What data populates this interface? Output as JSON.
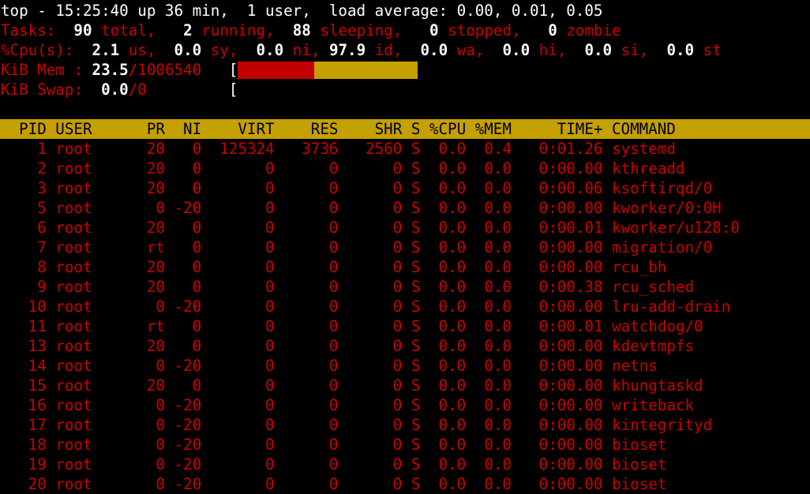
{
  "summary": {
    "line1": "top - 15:25:40 up 36 min,  1 user,  load average: 0.00, 0.01, 0.05",
    "tasks": {
      "label": "Tasks:",
      "total": "90",
      "total_label": "total,",
      "running": "2",
      "running_label": "running,",
      "sleeping": "88",
      "sleeping_label": "sleeping,",
      "stopped": "0",
      "stopped_label": "stopped,",
      "zombie": "0",
      "zombie_label": "zombie"
    },
    "cpu": {
      "label": "%Cpu(s):",
      "us": "2.1",
      "us_label": "us,",
      "sy": "0.0",
      "sy_label": "sy,",
      "ni": "0.0",
      "ni_label": "ni,",
      "id": "97.9",
      "id_label": "id,",
      "wa": "0.0",
      "wa_label": "wa,",
      "hi": "0.0",
      "hi_label": "hi,",
      "si": "0.0",
      "si_label": "si,",
      "st": "0.0",
      "st_label": "st"
    },
    "mem": {
      "label": "KiB Mem :",
      "used_pct": "23.5",
      "total": "/1006540",
      "bracket": "[",
      "bar_used_fraction": 0.425
    },
    "swap": {
      "label": "KiB Swap:",
      "used": "0.0",
      "total": "/0",
      "bracket": "["
    }
  },
  "header": "  PID USER      PR  NI    VIRT    RES    SHR S %CPU %MEM     TIME+ COMMAND",
  "columns": [
    "PID",
    "USER",
    "PR",
    "NI",
    "VIRT",
    "RES",
    "SHR",
    "S",
    "%CPU",
    "%MEM",
    "TIME+",
    "COMMAND"
  ],
  "processes": [
    {
      "pid": "1",
      "user": "root",
      "pr": "20",
      "ni": "0",
      "virt": "125324",
      "res": "3736",
      "shr": "2560",
      "s": "S",
      "cpu": "0.0",
      "mem": "0.4",
      "time": "0:01.26",
      "command": "systemd"
    },
    {
      "pid": "2",
      "user": "root",
      "pr": "20",
      "ni": "0",
      "virt": "0",
      "res": "0",
      "shr": "0",
      "s": "S",
      "cpu": "0.0",
      "mem": "0.0",
      "time": "0:00.00",
      "command": "kthreadd"
    },
    {
      "pid": "3",
      "user": "root",
      "pr": "20",
      "ni": "0",
      "virt": "0",
      "res": "0",
      "shr": "0",
      "s": "S",
      "cpu": "0.0",
      "mem": "0.0",
      "time": "0:00.06",
      "command": "ksoftirqd/0"
    },
    {
      "pid": "5",
      "user": "root",
      "pr": "0",
      "ni": "-20",
      "virt": "0",
      "res": "0",
      "shr": "0",
      "s": "S",
      "cpu": "0.0",
      "mem": "0.0",
      "time": "0:00.00",
      "command": "kworker/0:0H"
    },
    {
      "pid": "6",
      "user": "root",
      "pr": "20",
      "ni": "0",
      "virt": "0",
      "res": "0",
      "shr": "0",
      "s": "S",
      "cpu": "0.0",
      "mem": "0.0",
      "time": "0:00.01",
      "command": "kworker/u128:0"
    },
    {
      "pid": "7",
      "user": "root",
      "pr": "rt",
      "ni": "0",
      "virt": "0",
      "res": "0",
      "shr": "0",
      "s": "S",
      "cpu": "0.0",
      "mem": "0.0",
      "time": "0:00.00",
      "command": "migration/0"
    },
    {
      "pid": "8",
      "user": "root",
      "pr": "20",
      "ni": "0",
      "virt": "0",
      "res": "0",
      "shr": "0",
      "s": "S",
      "cpu": "0.0",
      "mem": "0.0",
      "time": "0:00.00",
      "command": "rcu_bh"
    },
    {
      "pid": "9",
      "user": "root",
      "pr": "20",
      "ni": "0",
      "virt": "0",
      "res": "0",
      "shr": "0",
      "s": "S",
      "cpu": "0.0",
      "mem": "0.0",
      "time": "0:00.38",
      "command": "rcu_sched"
    },
    {
      "pid": "10",
      "user": "root",
      "pr": "0",
      "ni": "-20",
      "virt": "0",
      "res": "0",
      "shr": "0",
      "s": "S",
      "cpu": "0.0",
      "mem": "0.0",
      "time": "0:00.00",
      "command": "lru-add-drain"
    },
    {
      "pid": "11",
      "user": "root",
      "pr": "rt",
      "ni": "0",
      "virt": "0",
      "res": "0",
      "shr": "0",
      "s": "S",
      "cpu": "0.0",
      "mem": "0.0",
      "time": "0:00.01",
      "command": "watchdog/0"
    },
    {
      "pid": "13",
      "user": "root",
      "pr": "20",
      "ni": "0",
      "virt": "0",
      "res": "0",
      "shr": "0",
      "s": "S",
      "cpu": "0.0",
      "mem": "0.0",
      "time": "0:00.00",
      "command": "kdevtmpfs"
    },
    {
      "pid": "14",
      "user": "root",
      "pr": "0",
      "ni": "-20",
      "virt": "0",
      "res": "0",
      "shr": "0",
      "s": "S",
      "cpu": "0.0",
      "mem": "0.0",
      "time": "0:00.00",
      "command": "netns"
    },
    {
      "pid": "15",
      "user": "root",
      "pr": "20",
      "ni": "0",
      "virt": "0",
      "res": "0",
      "shr": "0",
      "s": "S",
      "cpu": "0.0",
      "mem": "0.0",
      "time": "0:00.00",
      "command": "khungtaskd"
    },
    {
      "pid": "16",
      "user": "root",
      "pr": "0",
      "ni": "-20",
      "virt": "0",
      "res": "0",
      "shr": "0",
      "s": "S",
      "cpu": "0.0",
      "mem": "0.0",
      "time": "0:00.00",
      "command": "writeback"
    },
    {
      "pid": "17",
      "user": "root",
      "pr": "0",
      "ni": "-20",
      "virt": "0",
      "res": "0",
      "shr": "0",
      "s": "S",
      "cpu": "0.0",
      "mem": "0.0",
      "time": "0:00.00",
      "command": "kintegrityd"
    },
    {
      "pid": "18",
      "user": "root",
      "pr": "0",
      "ni": "-20",
      "virt": "0",
      "res": "0",
      "shr": "0",
      "s": "S",
      "cpu": "0.0",
      "mem": "0.0",
      "time": "0:00.00",
      "command": "bioset"
    },
    {
      "pid": "19",
      "user": "root",
      "pr": "0",
      "ni": "-20",
      "virt": "0",
      "res": "0",
      "shr": "0",
      "s": "S",
      "cpu": "0.0",
      "mem": "0.0",
      "time": "0:00.00",
      "command": "bioset"
    },
    {
      "pid": "20",
      "user": "root",
      "pr": "0",
      "ni": "-20",
      "virt": "0",
      "res": "0",
      "shr": "0",
      "s": "S",
      "cpu": "0.0",
      "mem": "0.0",
      "time": "0:00.00",
      "command": "bioset"
    }
  ],
  "colors": {
    "background": "#000000",
    "text_red": "#cc0000",
    "text_white": "#ffffff",
    "header_bg": "#c4a000",
    "mem_bar_used": "#c00000",
    "mem_bar_cache": "#c4a000"
  }
}
